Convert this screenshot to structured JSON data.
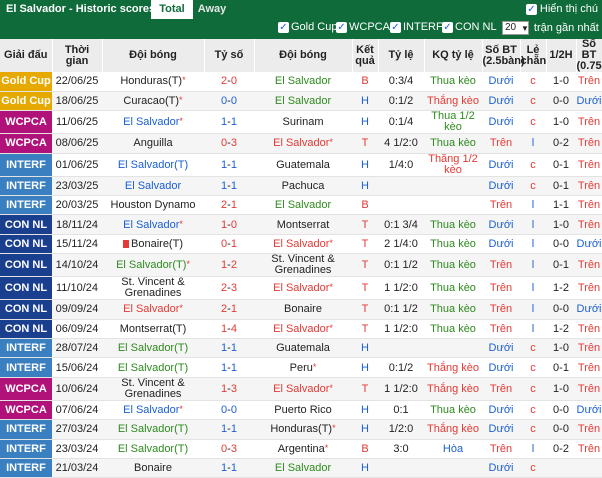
{
  "header": {
    "title": "El Salvador - Historic scores",
    "tabs": [
      "Total",
      "Away"
    ],
    "show_all_label": "Hiển thị chú"
  },
  "filters": {
    "items": [
      "Gold Cup",
      "WCPCA",
      "INTERF",
      "CON NL"
    ],
    "select_value": "20",
    "recent_label": "trận gần nhất"
  },
  "table": {
    "columns": [
      "Giải đấu",
      "Thời gian",
      "Đội bóng",
      "Tỷ số",
      "Đội bóng",
      "Kết quả",
      "Tỷ lệ",
      "KQ tỷ lệ",
      "Số BT (2.5bàn)",
      "Lẻ chẵn",
      "1/2H",
      "Số BT (0.75bàn)"
    ],
    "rows": [
      {
        "comp": "Gold Cup",
        "ccls": "c-gold",
        "date": "22/06/25",
        "home": "Honduras(T)*",
        "hcls": "",
        "h1": "2",
        "h2": "0",
        "scls": "red",
        "away": "El Salvador",
        "acls": "green",
        "res": "B",
        "rcls": "lose",
        "odds": "0:3/4",
        "kq": "Thua kèo",
        "kqcls": "win",
        "bt": "Dưới",
        "btcls": "draw",
        "lc": "c",
        "lccls": "lose",
        "half": "1-0",
        "bt2": "Trên",
        "bt2cls": "lose"
      },
      {
        "comp": "Gold Cup",
        "ccls": "c-gold",
        "date": "18/06/25",
        "home": "Curacao(T)*",
        "hcls": "",
        "h1": "0",
        "h2": "0",
        "scls": "blue",
        "away": "El Salvador",
        "acls": "green",
        "res": "H",
        "rcls": "draw",
        "odds": "0:1/2",
        "kq": "Thắng kèo",
        "kqcls": "lose",
        "bt": "Dưới",
        "btcls": "draw",
        "lc": "c",
        "lccls": "lose",
        "half": "0-0",
        "bt2": "Dưới",
        "bt2cls": "draw"
      },
      {
        "comp": "WCPCA",
        "ccls": "c-wcpca",
        "date": "11/06/25",
        "home": "El Salvador*",
        "hcls": "blue",
        "h1": "1",
        "h2": "1",
        "scls": "blue",
        "away": "Surinam",
        "acls": "",
        "res": "H",
        "rcls": "draw",
        "odds": "0:1/4",
        "kq": "Thua 1/2 kèo",
        "kqcls": "win",
        "bt": "Dưới",
        "btcls": "draw",
        "lc": "c",
        "lccls": "lose",
        "half": "1-0",
        "bt2": "Trên",
        "bt2cls": "lose"
      },
      {
        "comp": "WCPCA",
        "ccls": "c-wcpca",
        "date": "08/06/25",
        "home": "Anguilla",
        "hcls": "",
        "h1": "0",
        "h2": "3",
        "scls": "red",
        "away": "El Salvador*",
        "acls": "red",
        "res": "T",
        "rcls": "lose",
        "odds": "4 1/2:0",
        "kq": "Thua kèo",
        "kqcls": "win",
        "bt": "Trên",
        "btcls": "lose",
        "lc": "l",
        "lccls": "draw",
        "half": "0-2",
        "bt2": "Trên",
        "bt2cls": "lose"
      },
      {
        "comp": "INTERF",
        "ccls": "c-interf",
        "date": "01/06/25",
        "home": "El Salvador(T)",
        "hcls": "blue",
        "h1": "1",
        "h2": "1",
        "scls": "blue",
        "away": "Guatemala",
        "acls": "",
        "res": "H",
        "rcls": "draw",
        "odds": "1/4:0",
        "kq": "Thắng 1/2 kèo",
        "kqcls": "lose",
        "bt": "Dưới",
        "btcls": "draw",
        "lc": "c",
        "lccls": "lose",
        "half": "0-1",
        "bt2": "Trên",
        "bt2cls": "lose"
      },
      {
        "comp": "INTERF",
        "ccls": "c-interf",
        "date": "23/03/25",
        "home": "El Salvador",
        "hcls": "blue",
        "h1": "1",
        "h2": "1",
        "scls": "blue",
        "away": "Pachuca",
        "acls": "",
        "res": "H",
        "rcls": "draw",
        "odds": "",
        "kq": "",
        "kqcls": "",
        "bt": "Dưới",
        "btcls": "draw",
        "lc": "c",
        "lccls": "lose",
        "half": "0-1",
        "bt2": "Trên",
        "bt2cls": "lose"
      },
      {
        "comp": "INTERF",
        "ccls": "c-interf",
        "date": "20/03/25",
        "home": "Houston Dynamo",
        "hcls": "",
        "h1": "2",
        "h2": "1",
        "scls": "red",
        "away": "El Salvador",
        "acls": "green",
        "res": "B",
        "rcls": "lose",
        "odds": "",
        "kq": "",
        "kqcls": "",
        "bt": "Trên",
        "btcls": "lose",
        "lc": "l",
        "lccls": "draw",
        "half": "1-1",
        "bt2": "Trên",
        "bt2cls": "lose"
      },
      {
        "comp": "CON NL",
        "ccls": "c-connl",
        "date": "18/11/24",
        "home": "El Salvador*",
        "hcls": "blue",
        "h1": "1",
        "h2": "0",
        "scls": "red",
        "away": "Montserrat",
        "acls": "",
        "res": "T",
        "rcls": "lose",
        "odds": "0:1 3/4",
        "kq": "Thua kèo",
        "kqcls": "win",
        "bt": "Dưới",
        "btcls": "draw",
        "lc": "l",
        "lccls": "draw",
        "half": "1-0",
        "bt2": "Trên",
        "bt2cls": "lose"
      },
      {
        "comp": "CON NL",
        "ccls": "c-connl",
        "date": "15/11/24",
        "home": "Bonaire(T)",
        "hcls": "",
        "card": true,
        "h1": "0",
        "h2": "1",
        "scls": "red",
        "away": "El Salvador*",
        "acls": "red",
        "res": "T",
        "rcls": "lose",
        "odds": "2 1/4:0",
        "kq": "Thua kèo",
        "kqcls": "win",
        "bt": "Dưới",
        "btcls": "draw",
        "lc": "l",
        "lccls": "draw",
        "half": "0-0",
        "bt2": "Dưới",
        "bt2cls": "draw"
      },
      {
        "comp": "CON NL",
        "ccls": "c-connl",
        "date": "14/10/24",
        "home": "El Salvador(T)*",
        "hcls": "green",
        "h1": "1",
        "h2": "2",
        "scls": "red",
        "away": "St. Vincent & Grenadines",
        "acls": "",
        "res": "T",
        "rcls": "lose",
        "odds": "0:1 1/2",
        "kq": "Thua kèo",
        "kqcls": "win",
        "bt": "Trên",
        "btcls": "lose",
        "lc": "l",
        "lccls": "draw",
        "half": "0-1",
        "bt2": "Trên",
        "bt2cls": "lose"
      },
      {
        "comp": "CON NL",
        "ccls": "c-connl",
        "date": "11/10/24",
        "home": "St. Vincent & Grenadines",
        "hcls": "",
        "h1": "2",
        "h2": "3",
        "scls": "red",
        "away": "El Salvador*",
        "acls": "red",
        "res": "T",
        "rcls": "lose",
        "odds": "1 1/2:0",
        "kq": "Thua kèo",
        "kqcls": "win",
        "bt": "Trên",
        "btcls": "lose",
        "lc": "l",
        "lccls": "draw",
        "half": "1-2",
        "bt2": "Trên",
        "bt2cls": "lose"
      },
      {
        "comp": "CON NL",
        "ccls": "c-connl",
        "date": "09/09/24",
        "home": "El Salvador*",
        "hcls": "red",
        "h1": "2",
        "h2": "1",
        "scls": "red",
        "away": "Bonaire",
        "acls": "",
        "res": "T",
        "rcls": "lose",
        "odds": "0:1 1/2",
        "kq": "Thua kèo",
        "kqcls": "win",
        "bt": "Trên",
        "btcls": "lose",
        "lc": "l",
        "lccls": "draw",
        "half": "0-0",
        "bt2": "Dưới",
        "bt2cls": "draw"
      },
      {
        "comp": "CON NL",
        "ccls": "c-connl",
        "date": "06/09/24",
        "home": "Montserrat(T)",
        "hcls": "",
        "h1": "1",
        "h2": "4",
        "scls": "red",
        "away": "El Salvador*",
        "acls": "red",
        "res": "T",
        "rcls": "lose",
        "odds": "1 1/2:0",
        "kq": "Thua kèo",
        "kqcls": "win",
        "bt": "Trên",
        "btcls": "lose",
        "lc": "l",
        "lccls": "draw",
        "half": "1-2",
        "bt2": "Trên",
        "bt2cls": "lose"
      },
      {
        "comp": "INTERF",
        "ccls": "c-interf",
        "date": "28/07/24",
        "home": "El Salvador(T)",
        "hcls": "green",
        "h1": "1",
        "h2": "1",
        "scls": "blue",
        "away": "Guatemala",
        "acls": "",
        "res": "H",
        "rcls": "draw",
        "odds": "",
        "kq": "",
        "kqcls": "",
        "bt": "Dưới",
        "btcls": "draw",
        "lc": "c",
        "lccls": "lose",
        "half": "1-0",
        "bt2": "Trên",
        "bt2cls": "lose"
      },
      {
        "comp": "INTERF",
        "ccls": "c-interf",
        "date": "15/06/24",
        "home": "El Salvador(T)",
        "hcls": "green",
        "h1": "1",
        "h2": "1",
        "scls": "blue",
        "away": "Peru*",
        "acls": "",
        "res": "H",
        "rcls": "draw",
        "odds": "0:1/2",
        "kq": "Thắng kèo",
        "kqcls": "lose",
        "bt": "Dưới",
        "btcls": "draw",
        "lc": "c",
        "lccls": "lose",
        "half": "0-1",
        "bt2": "Trên",
        "bt2cls": "lose"
      },
      {
        "comp": "WCPCA",
        "ccls": "c-wcpca",
        "date": "10/06/24",
        "home": "St. Vincent & Grenadines",
        "hcls": "",
        "h1": "1",
        "h2": "3",
        "scls": "red",
        "away": "El Salvador*",
        "acls": "red",
        "res": "T",
        "rcls": "lose",
        "odds": "1 1/2:0",
        "kq": "Thắng kèo",
        "kqcls": "lose",
        "bt": "Trên",
        "btcls": "lose",
        "lc": "c",
        "lccls": "lose",
        "half": "1-0",
        "bt2": "Trên",
        "bt2cls": "lose"
      },
      {
        "comp": "WCPCA",
        "ccls": "c-wcpca",
        "date": "07/06/24",
        "home": "El Salvador*",
        "hcls": "blue",
        "h1": "0",
        "h2": "0",
        "scls": "blue",
        "away": "Puerto Rico",
        "acls": "",
        "res": "H",
        "rcls": "draw",
        "odds": "0:1",
        "kq": "Thua kèo",
        "kqcls": "win",
        "bt": "Dưới",
        "btcls": "draw",
        "lc": "c",
        "lccls": "lose",
        "half": "0-0",
        "bt2": "Dưới",
        "bt2cls": "draw"
      },
      {
        "comp": "INTERF",
        "ccls": "c-interf",
        "date": "27/03/24",
        "home": "El Salvador(T)",
        "hcls": "green",
        "h1": "1",
        "h2": "1",
        "scls": "blue",
        "away": "Honduras(T)*",
        "acls": "",
        "res": "H",
        "rcls": "draw",
        "odds": "1/2:0",
        "kq": "Thắng kèo",
        "kqcls": "lose",
        "bt": "Dưới",
        "btcls": "draw",
        "lc": "c",
        "lccls": "lose",
        "half": "0-0",
        "bt2": "Trên",
        "bt2cls": "lose"
      },
      {
        "comp": "INTERF",
        "ccls": "c-interf",
        "date": "23/03/24",
        "home": "El Salvador(T)",
        "hcls": "green",
        "h1": "0",
        "h2": "3",
        "scls": "red",
        "away": "Argentina*",
        "acls": "",
        "res": "B",
        "rcls": "lose",
        "odds": "3:0",
        "kq": "Hòa",
        "kqcls": "draw",
        "bt": "Trên",
        "btcls": "lose",
        "lc": "l",
        "lccls": "draw",
        "half": "0-2",
        "bt2": "Trên",
        "bt2cls": "lose"
      },
      {
        "comp": "INTERF",
        "ccls": "c-interf",
        "date": "21/03/24",
        "home": "Bonaire",
        "hcls": "",
        "h1": "1",
        "h2": "1",
        "scls": "blue",
        "away": "El Salvador",
        "acls": "green",
        "res": "H",
        "rcls": "draw",
        "odds": "",
        "kq": "",
        "kqcls": "",
        "bt": "Dưới",
        "btcls": "draw",
        "lc": "c",
        "lccls": "lose",
        "half": "",
        "bt2": "",
        "bt2cls": ""
      }
    ]
  }
}
